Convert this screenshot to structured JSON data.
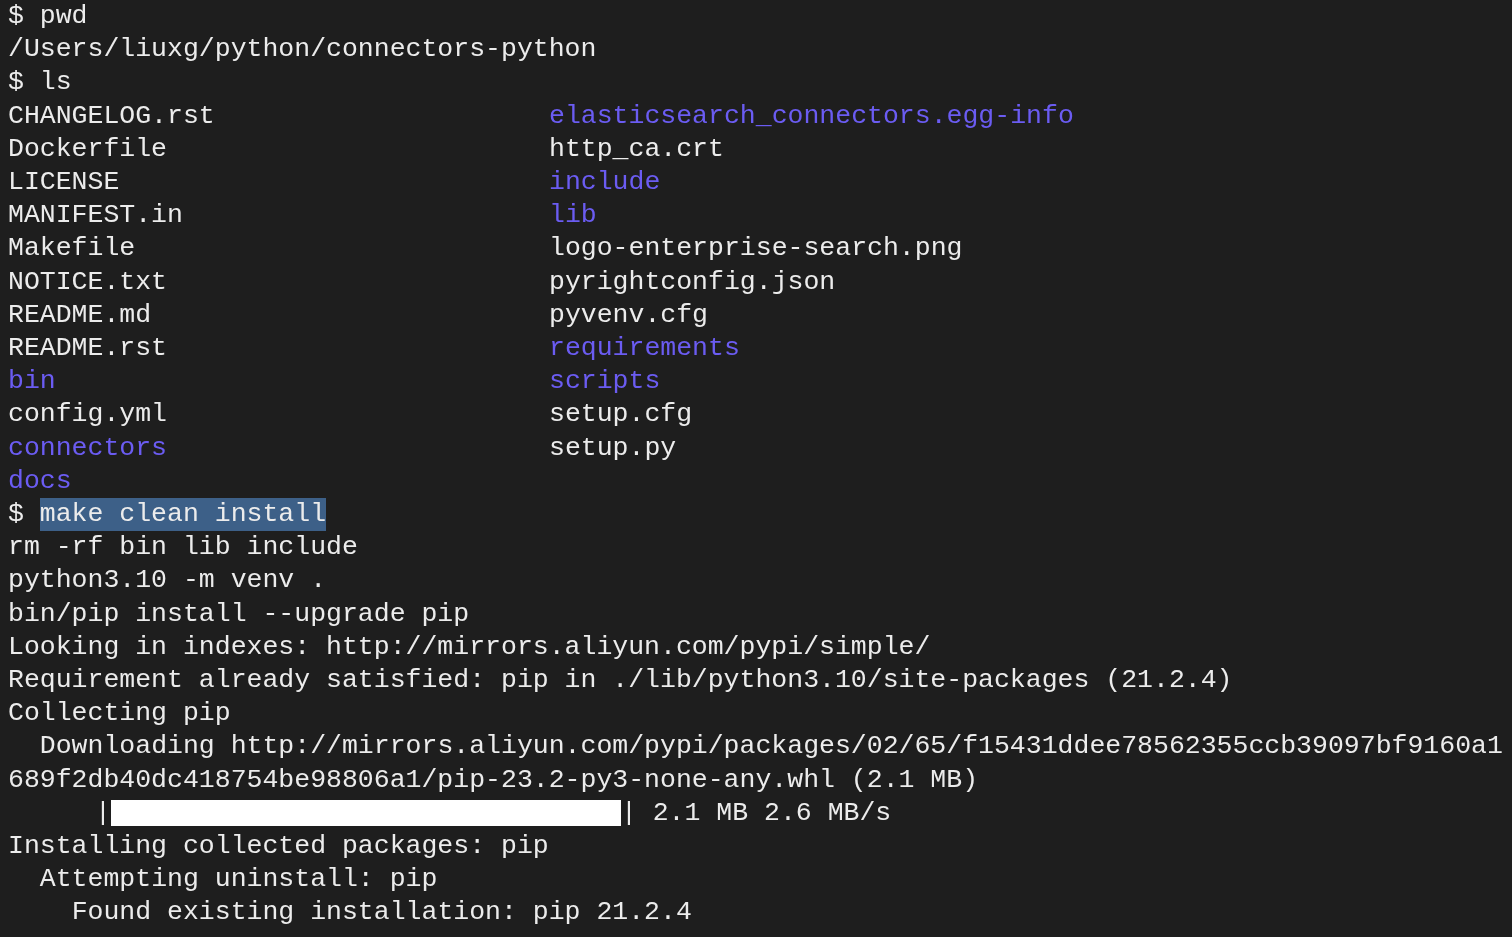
{
  "terminal": {
    "lines": [
      {
        "kind": "prompt",
        "prompt": "$",
        "command": "pwd",
        "selected": false
      },
      {
        "kind": "output",
        "text": "/Users/liuxg/python/connectors-python"
      },
      {
        "kind": "prompt",
        "prompt": "$",
        "command": "ls",
        "selected": false
      },
      {
        "kind": "listing",
        "left": {
          "name": "CHANGELOG.rst",
          "kind": "file"
        },
        "right": {
          "name": "elasticsearch_connectors.egg-info",
          "kind": "directory"
        }
      },
      {
        "kind": "listing",
        "left": {
          "name": "Dockerfile",
          "kind": "file"
        },
        "right": {
          "name": "http_ca.crt",
          "kind": "file"
        }
      },
      {
        "kind": "listing",
        "left": {
          "name": "LICENSE",
          "kind": "file"
        },
        "right": {
          "name": "include",
          "kind": "directory"
        }
      },
      {
        "kind": "listing",
        "left": {
          "name": "MANIFEST.in",
          "kind": "file"
        },
        "right": {
          "name": "lib",
          "kind": "directory"
        }
      },
      {
        "kind": "listing",
        "left": {
          "name": "Makefile",
          "kind": "file"
        },
        "right": {
          "name": "logo-enterprise-search.png",
          "kind": "file"
        }
      },
      {
        "kind": "listing",
        "left": {
          "name": "NOTICE.txt",
          "kind": "file"
        },
        "right": {
          "name": "pyrightconfig.json",
          "kind": "file"
        }
      },
      {
        "kind": "listing",
        "left": {
          "name": "README.md",
          "kind": "file"
        },
        "right": {
          "name": "pyvenv.cfg",
          "kind": "file"
        }
      },
      {
        "kind": "listing",
        "left": {
          "name": "README.rst",
          "kind": "file"
        },
        "right": {
          "name": "requirements",
          "kind": "directory"
        }
      },
      {
        "kind": "listing",
        "left": {
          "name": "bin",
          "kind": "directory"
        },
        "right": {
          "name": "scripts",
          "kind": "directory"
        }
      },
      {
        "kind": "listing",
        "left": {
          "name": "config.yml",
          "kind": "file"
        },
        "right": {
          "name": "setup.cfg",
          "kind": "file"
        }
      },
      {
        "kind": "listing",
        "left": {
          "name": "connectors",
          "kind": "directory"
        },
        "right": {
          "name": "setup.py",
          "kind": "file"
        }
      },
      {
        "kind": "listing",
        "left": {
          "name": "docs",
          "kind": "directory"
        }
      },
      {
        "kind": "prompt",
        "prompt": "$",
        "command": "make clean install",
        "selected": true
      },
      {
        "kind": "output",
        "text": "rm -rf bin lib include"
      },
      {
        "kind": "output",
        "text": "python3.10 -m venv ."
      },
      {
        "kind": "output",
        "text": "bin/pip install --upgrade pip"
      },
      {
        "kind": "output",
        "text": "Looking in indexes: http://mirrors.aliyun.com/pypi/simple/"
      },
      {
        "kind": "output",
        "text": "Requirement already satisfied: pip in ./lib/python3.10/site-packages (21.2.4)"
      },
      {
        "kind": "output",
        "text": "Collecting pip"
      },
      {
        "kind": "output",
        "text": "  Downloading http://mirrors.aliyun.com/pypi/packages/02/65/f15431ddee78562355ccb39097bf9160a1689f2db40dc418754be98806a1/pip-23.2-py3-none-any.whl (2.1 MB)"
      },
      {
        "kind": "progress",
        "left_cap": "|",
        "right_cap": "|",
        "level": 1,
        "reading": "2.1 MB 2.6 MB/s"
      },
      {
        "kind": "output",
        "text": "Installing collected packages: pip"
      },
      {
        "kind": "output",
        "text": "  Attempting uninstall: pip"
      },
      {
        "kind": "output",
        "text": "    Found existing installation: pip 21.2.4"
      }
    ]
  }
}
